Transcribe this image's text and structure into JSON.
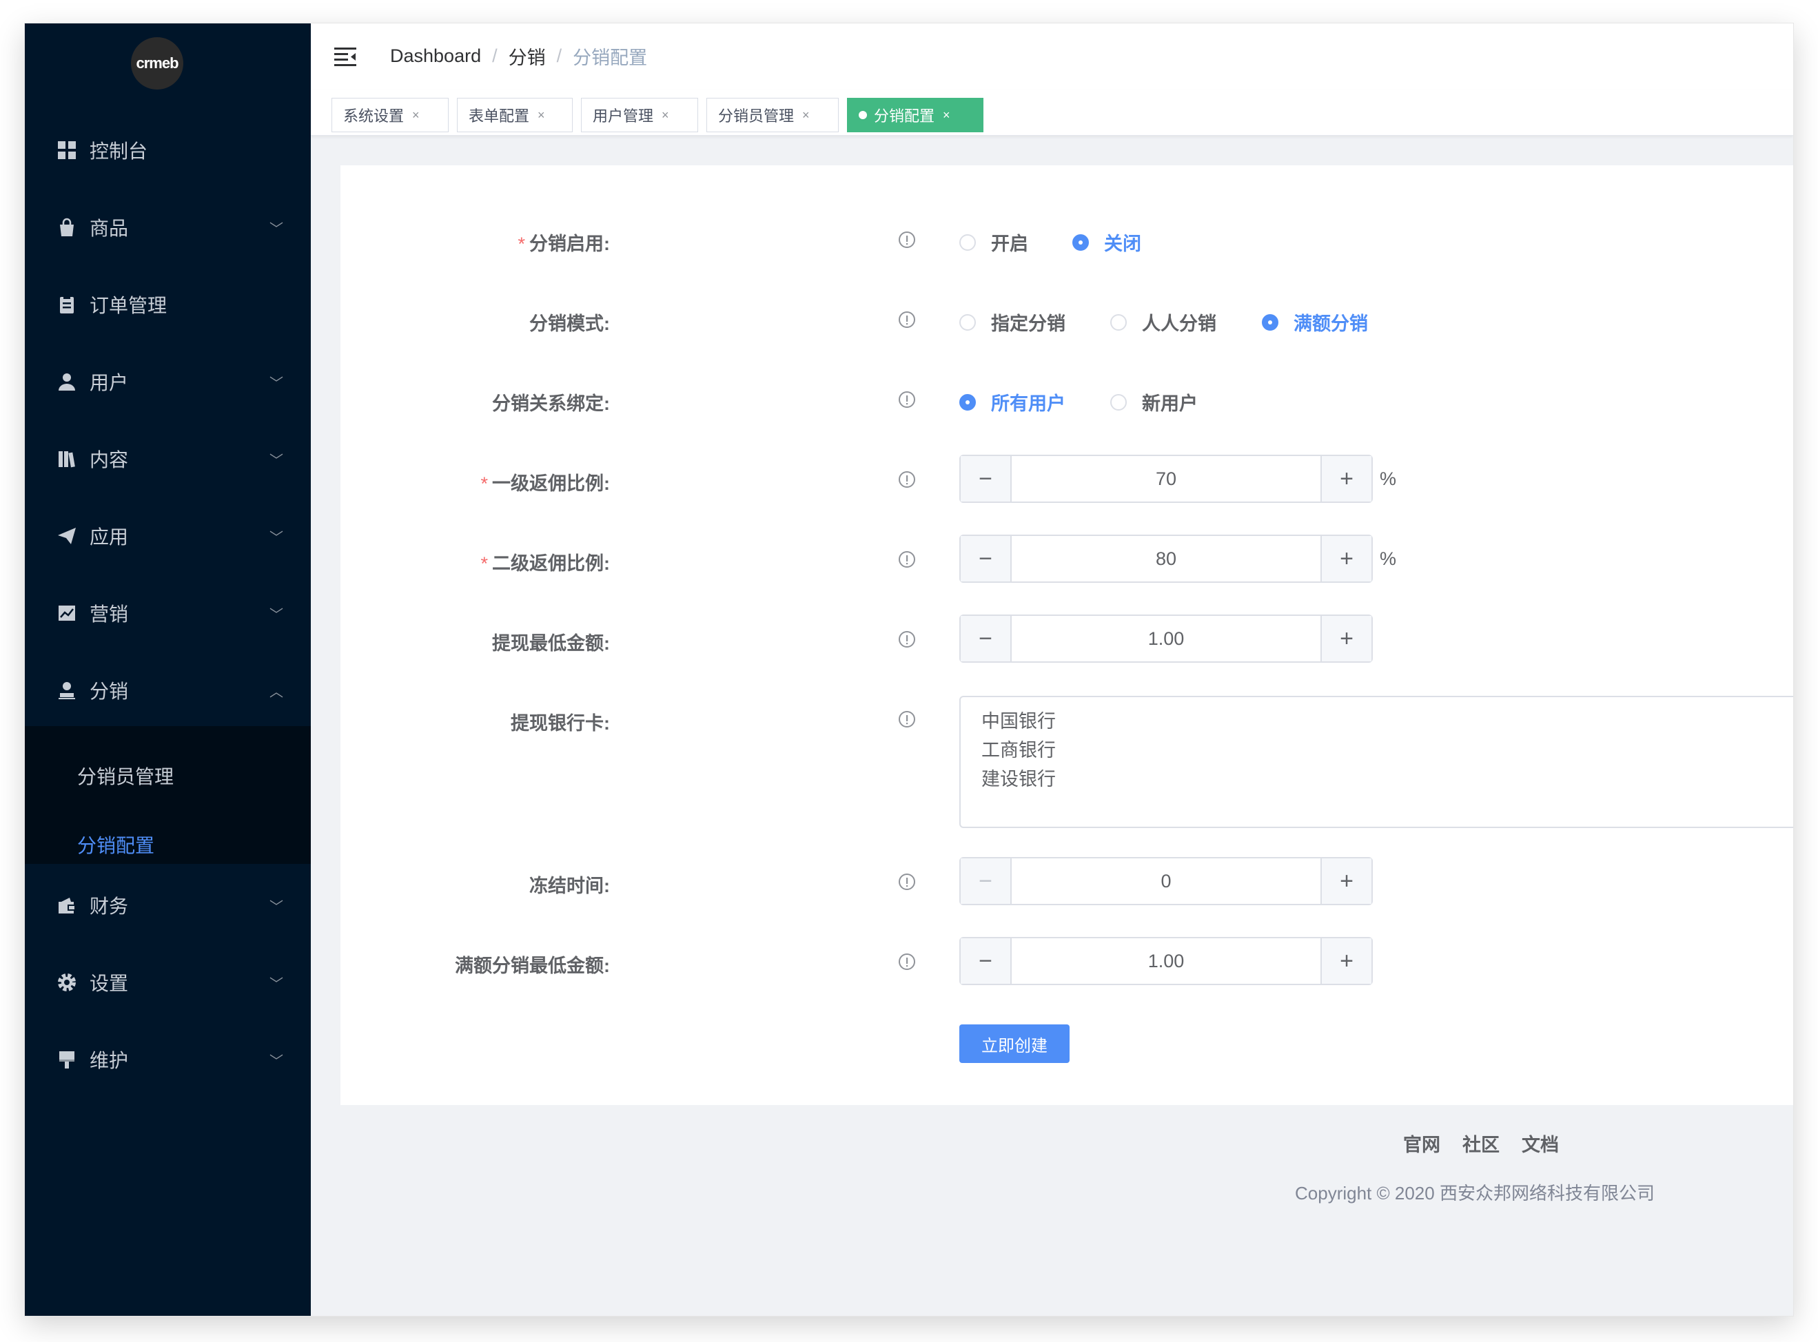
{
  "sidebar": {
    "logo_text": "crmeb",
    "items": [
      {
        "label": "控制台",
        "icon": "dashboard-icon",
        "arrow": ""
      },
      {
        "label": "商品",
        "icon": "shopping-bag-icon",
        "arrow": "﹀"
      },
      {
        "label": "订单管理",
        "icon": "clipboard-icon",
        "arrow": ""
      },
      {
        "label": "用户",
        "icon": "user-icon",
        "arrow": "﹀"
      },
      {
        "label": "内容",
        "icon": "library-icon",
        "arrow": "﹀"
      },
      {
        "label": "应用",
        "icon": "paper-plane-icon",
        "arrow": "﹀"
      },
      {
        "label": "营销",
        "icon": "chart-icon",
        "arrow": "﹀"
      },
      {
        "label": "分销",
        "icon": "distribution-user-icon",
        "arrow": "︿"
      },
      {
        "label": "财务",
        "icon": "wallet-icon",
        "arrow": "﹀"
      },
      {
        "label": "设置",
        "icon": "gear-icon",
        "arrow": "﹀"
      },
      {
        "label": "维护",
        "icon": "brush-icon",
        "arrow": "﹀"
      }
    ],
    "submenu": [
      "分销员管理",
      "分销配置"
    ],
    "active_sub": "分销配置"
  },
  "breadcrumb": {
    "items": [
      "Dashboard",
      "分销"
    ],
    "current": "分销配置",
    "separator": "/"
  },
  "tags": [
    {
      "label": "系统设置",
      "close": "×"
    },
    {
      "label": "表单配置",
      "close": "×"
    },
    {
      "label": "用户管理",
      "close": "×"
    },
    {
      "label": "分销员管理",
      "close": "×"
    },
    {
      "label": "分销配置",
      "close": "×",
      "active": true
    }
  ],
  "form": {
    "enable": {
      "label": "分销启用:",
      "required": "*",
      "options": [
        "开启",
        "关闭"
      ],
      "selected": "关闭"
    },
    "mode": {
      "label": "分销模式:",
      "options": [
        "指定分销",
        "人人分销",
        "满额分销"
      ],
      "selected": "满额分销"
    },
    "binding": {
      "label": "分销关系绑定:",
      "options": [
        "所有用户",
        "新用户"
      ],
      "selected": "所有用户"
    },
    "level1": {
      "label": "一级返佣比例:",
      "required": "*",
      "value": "70",
      "unit": "%"
    },
    "level2": {
      "label": "二级返佣比例:",
      "required": "*",
      "value": "80",
      "unit": "%"
    },
    "min_withdraw": {
      "label": "提现最低金额:",
      "value": "1.00"
    },
    "bank_cards": {
      "label": "提现银行卡:",
      "lines": [
        "中国银行",
        "工商银行",
        "建设银行"
      ]
    },
    "freeze": {
      "label": "冻结时间:",
      "value": "0"
    },
    "full_min": {
      "label": "满额分销最低金额:",
      "value": "1.00"
    },
    "submit_label": "立即创建"
  },
  "footer": {
    "links": [
      "官网",
      "社区",
      "文档"
    ],
    "copyright": "Copyright © 2020 西安众邦网络科技有限公司"
  },
  "colors": {
    "sidebar_bg": "#001529",
    "primary": "#4f8ef7",
    "active_tag": "#42b983",
    "required": "#f56c6c"
  }
}
